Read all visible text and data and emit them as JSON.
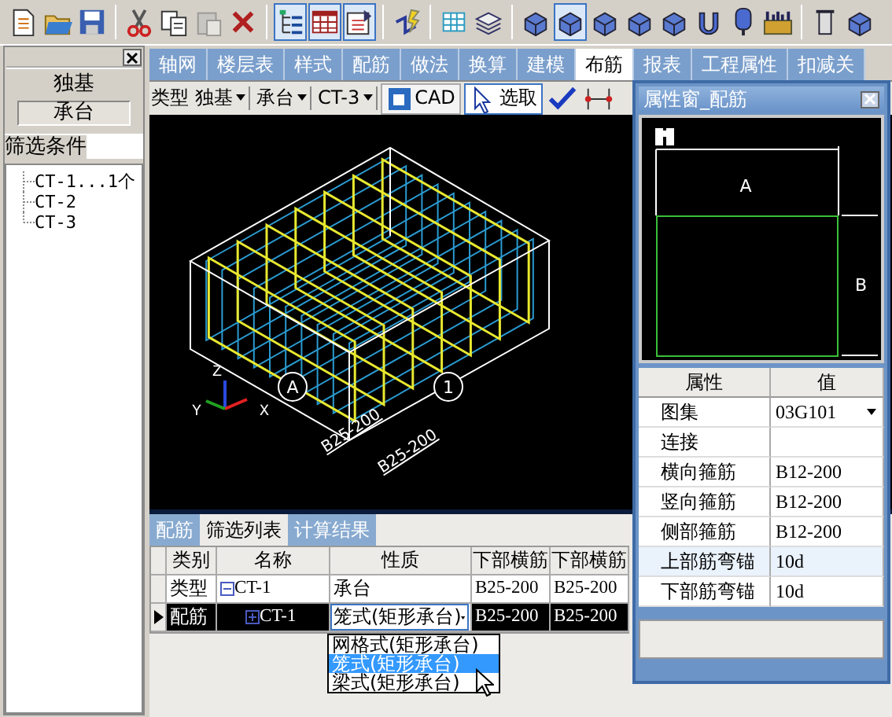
{
  "toolbar": [
    {
      "kind": "document",
      "pressed": false,
      "disabled": false
    },
    {
      "kind": "folder",
      "pressed": false,
      "disabled": false
    },
    {
      "kind": "save",
      "pressed": false,
      "disabled": false
    },
    {
      "kind": "sep"
    },
    {
      "kind": "scissors",
      "pressed": false,
      "disabled": false
    },
    {
      "kind": "copy",
      "pressed": false,
      "disabled": false
    },
    {
      "kind": "paste",
      "pressed": false,
      "disabled": true
    },
    {
      "kind": "delete",
      "pressed": false,
      "disabled": false
    },
    {
      "kind": "sep"
    },
    {
      "kind": "tree",
      "pressed": true,
      "disabled": false
    },
    {
      "kind": "table",
      "pressed": true,
      "disabled": false
    },
    {
      "kind": "form",
      "pressed": true,
      "disabled": false
    },
    {
      "kind": "sep"
    },
    {
      "kind": "lightning",
      "pressed": false,
      "disabled": false
    },
    {
      "kind": "sep"
    },
    {
      "kind": "grid",
      "pressed": false,
      "disabled": false
    },
    {
      "kind": "layers",
      "pressed": false,
      "disabled": false
    },
    {
      "kind": "sep"
    },
    {
      "kind": "block",
      "pressed": false,
      "disabled": false
    },
    {
      "kind": "block",
      "pressed": true,
      "disabled": false
    },
    {
      "kind": "block",
      "pressed": false,
      "disabled": false
    },
    {
      "kind": "block",
      "pressed": false,
      "disabled": false
    },
    {
      "kind": "block",
      "pressed": false,
      "disabled": false
    },
    {
      "kind": "cup",
      "pressed": false,
      "disabled": false
    },
    {
      "kind": "pin",
      "pressed": false,
      "disabled": false
    },
    {
      "kind": "ruler",
      "pressed": false,
      "disabled": false
    },
    {
      "kind": "sep"
    },
    {
      "kind": "column",
      "pressed": false,
      "disabled": false
    },
    {
      "kind": "block",
      "pressed": false,
      "disabled": false
    }
  ],
  "left_panel": {
    "types": [
      {
        "label": "独基",
        "selected": false
      },
      {
        "label": "承台",
        "selected": true
      }
    ],
    "filter_label": "筛选条件",
    "tree": [
      {
        "label": "CT-1...1个"
      },
      {
        "label": "CT-2"
      },
      {
        "label": "CT-3"
      }
    ]
  },
  "tabs": [
    {
      "label": "轴网",
      "selected": false
    },
    {
      "label": "楼层表",
      "selected": false
    },
    {
      "label": "样式",
      "selected": false
    },
    {
      "label": "配筋",
      "selected": false
    },
    {
      "label": "做法",
      "selected": false
    },
    {
      "label": "换算",
      "selected": false
    },
    {
      "label": "建模",
      "selected": false
    },
    {
      "label": "布筋",
      "selected": true
    },
    {
      "label": "报表",
      "selected": false
    },
    {
      "label": "工程属性",
      "selected": false
    },
    {
      "label": "扣减关",
      "selected": false
    }
  ],
  "type_bar": {
    "label": "类型",
    "combos": [
      "独基",
      "承台",
      "CT-3"
    ],
    "buttons": [
      {
        "label": "CAD",
        "kind": "cad",
        "pressed": false
      },
      {
        "label": "选取",
        "kind": "pointer",
        "pressed": true
      }
    ],
    "tools": [
      {
        "kind": "check"
      },
      {
        "kind": "crosshair"
      }
    ]
  },
  "canvas": {
    "axes": [
      "Z",
      "Y",
      "X"
    ],
    "grid_markers": [
      "A",
      "1"
    ],
    "dimension_labels": [
      "B25-200",
      "B25-200"
    ]
  },
  "bottom_tabs": [
    {
      "label": "配筋",
      "selected": false
    },
    {
      "label": "筛选列表",
      "selected": true
    },
    {
      "label": "计算结果",
      "selected": false
    }
  ],
  "table": {
    "columns": [
      "类别",
      "名称",
      "性质",
      "下部横筋",
      "下部横筋"
    ],
    "rows": [
      {
        "selected": false,
        "expanded": true,
        "cells": [
          "类型",
          "CT-1",
          "承台",
          "B25-200",
          "B25-200"
        ]
      },
      {
        "selected": true,
        "expanded": false,
        "cells": [
          "配筋",
          "CT-1",
          "笼式(矩形承台)",
          "B25-200",
          "B25-200"
        ]
      }
    ]
  },
  "dropdown": {
    "options": [
      {
        "label": "网格式(矩形承台)",
        "selected": false
      },
      {
        "label": "笼式(矩形承台)",
        "selected": true
      },
      {
        "label": "梁式(矩形承台)",
        "selected": false
      }
    ]
  },
  "property_window": {
    "title": "属性窗_配筋",
    "preview_labels": [
      "A",
      "B"
    ],
    "columns": [
      "属性",
      "值"
    ],
    "rows": [
      {
        "name": "图集",
        "value": "03G101",
        "kind": "select",
        "selected": false
      },
      {
        "name": "连接",
        "kind": "text",
        "selected": false
      },
      {
        "name": "横向箍筋",
        "value": "B12-200",
        "kind": "text",
        "selected": false
      },
      {
        "name": "竖向箍筋",
        "value": "B12-200",
        "kind": "text",
        "selected": false
      },
      {
        "name": "侧部箍筋",
        "value": "B12-200",
        "kind": "text",
        "selected": false
      },
      {
        "name": "上部筋弯锚",
        "value": "10d",
        "kind": "text",
        "selected": true
      },
      {
        "name": "下部筋弯锚",
        "value": "10d",
        "kind": "text",
        "selected": false
      }
    ]
  }
}
